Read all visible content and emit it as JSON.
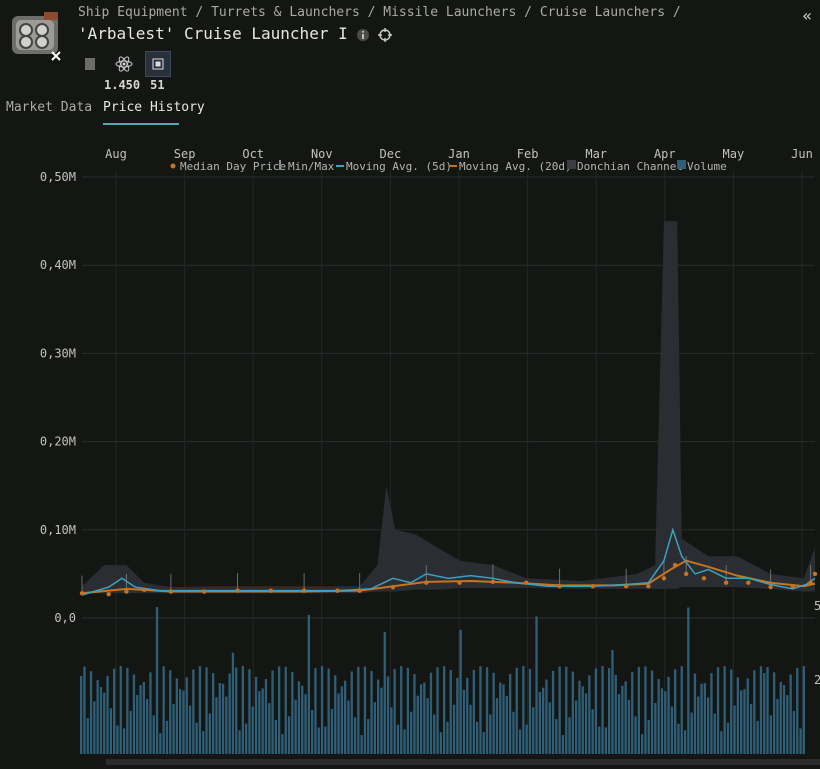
{
  "breadcrumb": [
    "Ship Equipment",
    "/",
    "Turrets & Launchers",
    "/",
    "Missile Launchers",
    "/",
    "Cruise Launchers",
    "/"
  ],
  "title": "'Arbalest' Cruise Launcher I",
  "icons": {
    "collapse": "double-chevron-left-icon",
    "info": "info-icon",
    "target": "crosshair-icon",
    "attr1": "module-icon",
    "attr2": "atom-icon",
    "attr3": "cpu-icon"
  },
  "attributes": {
    "volume_value": "1.450",
    "cpu_value": "51"
  },
  "tabs": [
    {
      "label": "Market Data",
      "active": false
    },
    {
      "label": "Price History",
      "active": true
    }
  ],
  "colors": {
    "background": "#141614",
    "accent": "#5aa6b4",
    "median": "#c8741f",
    "moving5": "#3f9fbf",
    "moving20": "#c8741f",
    "donchian": "#2b2e33",
    "volume": "#2f5f78",
    "minmax": "#8b8e92"
  },
  "chart_data": {
    "type": "line",
    "title": "",
    "months": [
      "Aug",
      "Sep",
      "Oct",
      "Nov",
      "Dec",
      "Jan",
      "Feb",
      "Mar",
      "Apr",
      "May",
      "Jun"
    ],
    "legend": [
      "Median Day Price",
      "Min/Max",
      "Moving Avg. (5d)",
      "Moving Avg. (20d)",
      "Donchian Channel",
      "Volume"
    ],
    "y_ticks": [
      "0,50M",
      "0,40M",
      "0,30M",
      "0,20M",
      "0,10M",
      "0,0"
    ],
    "ylim": [
      0,
      0.5
    ],
    "y_unit": "M ISK",
    "volume_axis_ticks": [
      "5",
      "2"
    ],
    "x_range_days": [
      0,
      330
    ],
    "median": [
      [
        0,
        0.028
      ],
      [
        12,
        0.027
      ],
      [
        20,
        0.03
      ],
      [
        28,
        0.032
      ],
      [
        40,
        0.03
      ],
      [
        55,
        0.03
      ],
      [
        70,
        0.031
      ],
      [
        85,
        0.031
      ],
      [
        100,
        0.031
      ],
      [
        115,
        0.031
      ],
      [
        125,
        0.031
      ],
      [
        140,
        0.035
      ],
      [
        155,
        0.04
      ],
      [
        170,
        0.04
      ],
      [
        185,
        0.041
      ],
      [
        200,
        0.04
      ],
      [
        215,
        0.036
      ],
      [
        230,
        0.036
      ],
      [
        245,
        0.036
      ],
      [
        255,
        0.036
      ],
      [
        262,
        0.045
      ],
      [
        267,
        0.06
      ],
      [
        272,
        0.05
      ],
      [
        280,
        0.045
      ],
      [
        290,
        0.04
      ],
      [
        300,
        0.04
      ],
      [
        310,
        0.035
      ],
      [
        320,
        0.036
      ],
      [
        328,
        0.04
      ],
      [
        330,
        0.05
      ]
    ],
    "moving_avg_5d": [
      [
        0,
        0.026
      ],
      [
        12,
        0.035
      ],
      [
        18,
        0.045
      ],
      [
        24,
        0.035
      ],
      [
        35,
        0.031
      ],
      [
        55,
        0.031
      ],
      [
        75,
        0.031
      ],
      [
        95,
        0.031
      ],
      [
        115,
        0.031
      ],
      [
        130,
        0.033
      ],
      [
        140,
        0.045
      ],
      [
        148,
        0.04
      ],
      [
        155,
        0.05
      ],
      [
        165,
        0.045
      ],
      [
        175,
        0.048
      ],
      [
        185,
        0.045
      ],
      [
        195,
        0.04
      ],
      [
        210,
        0.036
      ],
      [
        230,
        0.036
      ],
      [
        245,
        0.038
      ],
      [
        255,
        0.04
      ],
      [
        262,
        0.065
      ],
      [
        266,
        0.1
      ],
      [
        270,
        0.07
      ],
      [
        276,
        0.05
      ],
      [
        282,
        0.055
      ],
      [
        290,
        0.045
      ],
      [
        300,
        0.045
      ],
      [
        310,
        0.038
      ],
      [
        320,
        0.033
      ],
      [
        326,
        0.038
      ],
      [
        330,
        0.045
      ]
    ],
    "moving_avg_20d": [
      [
        0,
        0.028
      ],
      [
        20,
        0.033
      ],
      [
        40,
        0.03
      ],
      [
        70,
        0.03
      ],
      [
        100,
        0.03
      ],
      [
        125,
        0.031
      ],
      [
        140,
        0.036
      ],
      [
        155,
        0.041
      ],
      [
        175,
        0.042
      ],
      [
        195,
        0.04
      ],
      [
        215,
        0.037
      ],
      [
        240,
        0.037
      ],
      [
        255,
        0.039
      ],
      [
        265,
        0.055
      ],
      [
        272,
        0.065
      ],
      [
        282,
        0.058
      ],
      [
        295,
        0.048
      ],
      [
        310,
        0.04
      ],
      [
        325,
        0.036
      ],
      [
        330,
        0.039
      ]
    ],
    "volume_axis": "right",
    "notes": [
      "Donchian band spikes near Dec (~0.15M) and Apr (~0.45M)"
    ]
  }
}
